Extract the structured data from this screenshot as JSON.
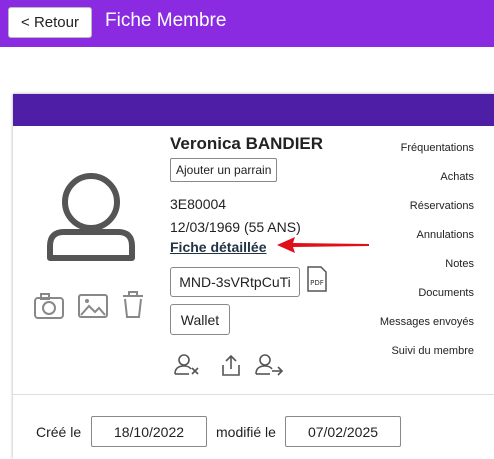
{
  "header": {
    "back_label": "< Retour",
    "title": "Fiche Membre",
    "bar_color": "#8a2be2"
  },
  "card": {
    "header_color": "#4e1fa6",
    "member": {
      "name": "Veronica BANDIER",
      "sponsor_button": "Ajouter un parrain",
      "id": "3E80004",
      "birth": "12/03/1969 (55 ANS)",
      "detail_link": "Fiche détaillée",
      "code": "MND-3sVRtpCuTi",
      "wallet": "Wallet",
      "pdf_icon_label": "PDF"
    },
    "side_menu": [
      "Fréquentations",
      "Achats",
      "Réservations",
      "Annulations",
      "Notes",
      "Documents",
      "Messages envoyés",
      "Suivi du membre"
    ],
    "footer": {
      "created_label": "Créé le",
      "created_date": "18/10/2022",
      "modified_label": "modifié le",
      "modified_date": "07/02/2025"
    }
  },
  "icons": {
    "avatar": "user-avatar-icon",
    "photo": [
      "camera-icon",
      "image-icon",
      "trash-icon"
    ],
    "actions": [
      "user-remove-icon",
      "upload-icon",
      "user-transfer-icon"
    ],
    "arrow_color": "#e0101a"
  }
}
